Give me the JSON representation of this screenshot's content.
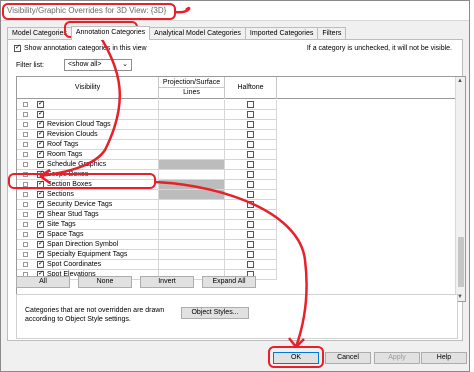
{
  "dialog": {
    "title": "Visibility/Graphic Overrides for 3D View: {3D}"
  },
  "tabs": [
    {
      "label": "Model Categories",
      "active": false
    },
    {
      "label": "Annotation Categories",
      "active": true
    },
    {
      "label": "Analytical Model Categories",
      "active": false
    },
    {
      "label": "Imported Categories",
      "active": false
    },
    {
      "label": "Filters",
      "active": false
    }
  ],
  "panel": {
    "show_annotation_label": "Show annotation categories in this view",
    "show_annotation_checked": true,
    "uncheck_note": "If a category is unchecked, it will not be visible.",
    "filter_label": "Filter list:",
    "filter_value": "<show all>"
  },
  "grid": {
    "headers": {
      "visibility": "Visibility",
      "projection_top": "Projection/Surface",
      "projection_sub": "Lines",
      "halftone": "Halftone"
    },
    "rows": [
      {
        "label": "",
        "checked": true,
        "proj_gray": false
      },
      {
        "label": "",
        "checked": true,
        "proj_gray": false
      },
      {
        "label": "Revision Cloud Tags",
        "checked": true,
        "proj_gray": false
      },
      {
        "label": "Revision Clouds",
        "checked": true,
        "proj_gray": false
      },
      {
        "label": "Roof Tags",
        "checked": true,
        "proj_gray": false
      },
      {
        "label": "Room Tags",
        "checked": true,
        "proj_gray": false
      },
      {
        "label": "Schedule Graphics",
        "checked": true,
        "proj_gray": true
      },
      {
        "label": "Scope Boxes",
        "checked": true,
        "proj_gray": false
      },
      {
        "label": "Section Boxes",
        "checked": true,
        "proj_gray": true
      },
      {
        "label": "Sections",
        "checked": true,
        "proj_gray": true
      },
      {
        "label": "Security Device Tags",
        "checked": true,
        "proj_gray": false
      },
      {
        "label": "Shear Stud Tags",
        "checked": true,
        "proj_gray": false
      },
      {
        "label": "Site Tags",
        "checked": true,
        "proj_gray": false
      },
      {
        "label": "Space Tags",
        "checked": true,
        "proj_gray": false
      },
      {
        "label": "Span Direction Symbol",
        "checked": true,
        "proj_gray": false
      },
      {
        "label": "Specialty Equipment Tags",
        "checked": true,
        "proj_gray": false
      },
      {
        "label": "Spot Coordinates",
        "checked": true,
        "proj_gray": false
      },
      {
        "label": "Spot Elevations",
        "checked": true,
        "proj_gray": false
      }
    ]
  },
  "buttons": {
    "all": "All",
    "none": "None",
    "invert": "Invert",
    "expand_all": "Expand All",
    "object_styles": "Object Styles...",
    "ok": "OK",
    "cancel": "Cancel",
    "apply": "Apply",
    "help": "Help"
  },
  "info": {
    "text": "Categories that are not overridden are drawn according to Object Style settings."
  },
  "colors": {
    "annotation": "#e8202a",
    "cell_gray": "#bcbcbc",
    "focus": "#0078d7"
  }
}
